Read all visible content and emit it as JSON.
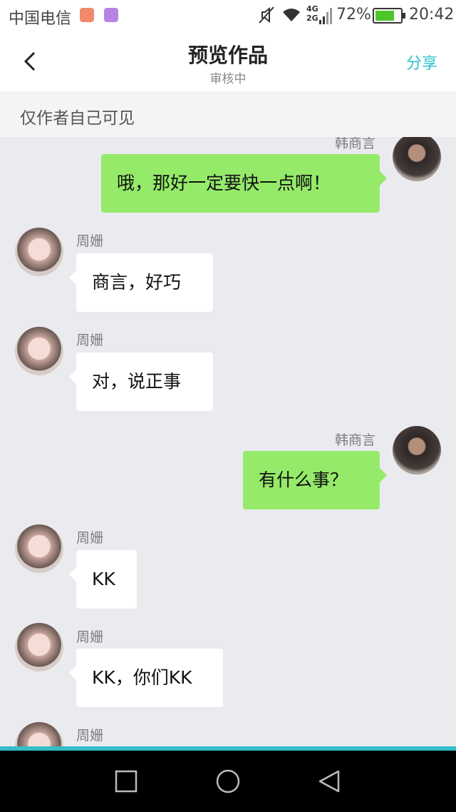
{
  "status_bar": {
    "carrier": "中国电信",
    "network_top": "4G",
    "network_bottom": "2G",
    "battery": "72%",
    "time": "20:42"
  },
  "header": {
    "title": "预览作品",
    "subtitle": "审核中",
    "share_label": "分享"
  },
  "notice": {
    "text": "仅作者自己可见"
  },
  "messages": [
    {
      "sender": "韩商言",
      "text": "哦，那好一定要快一点啊！",
      "side": "right"
    },
    {
      "sender": "周姗",
      "text": "商言，好巧",
      "side": "left"
    },
    {
      "sender": "周姗",
      "text": "对，说正事",
      "side": "left"
    },
    {
      "sender": "韩商言",
      "text": "有什么事？",
      "side": "right"
    },
    {
      "sender": "周姗",
      "text": "KK",
      "side": "left"
    },
    {
      "sender": "周姗",
      "text": "KK，你们KK",
      "side": "left"
    },
    {
      "sender": "周姗",
      "text": "",
      "side": "left"
    }
  ],
  "icons": {
    "back": "back-icon",
    "mute": "mute-icon",
    "wifi": "wifi-icon",
    "battery": "battery-icon",
    "nav_recent": "recent-apps-icon",
    "nav_home": "home-icon",
    "nav_back": "nav-back-icon"
  },
  "colors": {
    "accent": "#2ec0cc",
    "bubble_self": "#95ea6a",
    "bubble_other": "#ffffff",
    "chat_bg": "#eaebef"
  }
}
